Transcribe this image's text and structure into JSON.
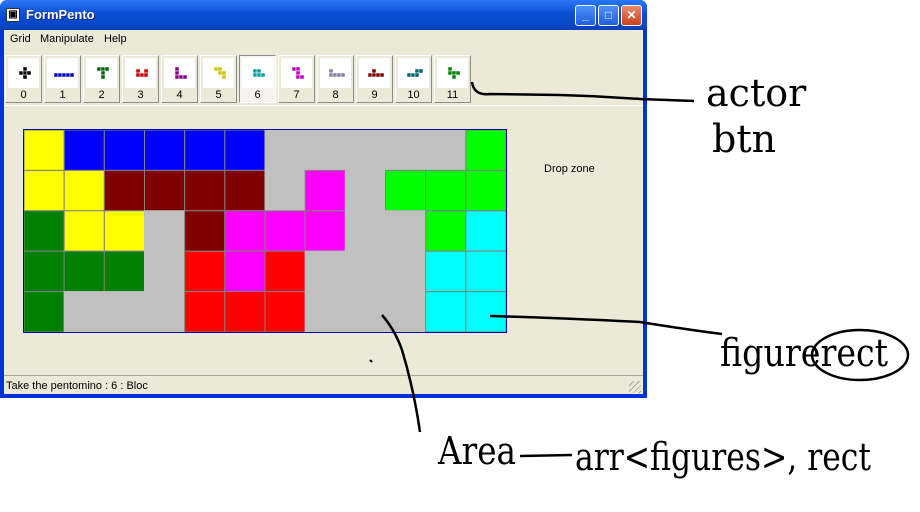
{
  "window": {
    "title": "FormPento",
    "app_icon": "app-icon",
    "controls": {
      "minimize": "_",
      "maximize": "□",
      "close": "✕"
    }
  },
  "menu": [
    {
      "label": "Grid",
      "accel": "G"
    },
    {
      "label": "Manipulate",
      "accel": "M"
    },
    {
      "label": "Help",
      "accel": "H"
    }
  ],
  "toolbar": {
    "selected_index": 6,
    "buttons": [
      {
        "label": "0",
        "color": "#000000"
      },
      {
        "label": "1",
        "color": "#0000c8"
      },
      {
        "label": "2",
        "color": "#006400"
      },
      {
        "label": "3",
        "color": "#c80000"
      },
      {
        "label": "4",
        "color": "#800080"
      },
      {
        "label": "5",
        "color": "#c8c800"
      },
      {
        "label": "6",
        "color": "#00a0a0"
      },
      {
        "label": "7",
        "color": "#c000c0"
      },
      {
        "label": "8",
        "color": "#8080a0"
      },
      {
        "label": "9",
        "color": "#800000"
      },
      {
        "label": "10",
        "color": "#006464"
      },
      {
        "label": "11",
        "color": "#008000"
      }
    ]
  },
  "board": {
    "cols": 12,
    "rows": 5,
    "empty_color": "#c0c0c0",
    "cells": [
      [
        "#ffff00",
        "#0000ff",
        "#0000ff",
        "#0000ff",
        "#0000ff",
        "#0000ff",
        "",
        "",
        "",
        "",
        "",
        "#00ff00"
      ],
      [
        "#ffff00",
        "#ffff00",
        "#800000",
        "#800000",
        "#800000",
        "#800000",
        "",
        "#ff00ff",
        "",
        "#00ff00",
        "#00ff00",
        "#00ff00"
      ],
      [
        "#008000",
        "#ffff00",
        "#ffff00",
        "",
        "#800000",
        "#ff00ff",
        "#ff00ff",
        "#ff00ff",
        "",
        "",
        "#00ff00",
        "#00ffff"
      ],
      [
        "#008000",
        "#008000",
        "#008000",
        "",
        "#ff0000",
        "#ff00ff",
        "#ff0000",
        "",
        "",
        "",
        "#00ffff",
        "#00ffff"
      ],
      [
        "#008000",
        "",
        "",
        "",
        "#ff0000",
        "#ff0000",
        "#ff0000",
        "",
        "",
        "",
        "#00ffff",
        "#00ffff"
      ]
    ]
  },
  "drop_zone_label": "Drop zone",
  "status": "Take the pentomino : 6 : Bloc",
  "annotations": {
    "actor_btn_line1": "actor",
    "actor_btn_line2": "btn",
    "figure_rect": "figurerect",
    "area_left": "Area",
    "area_right": "arr<figures>, rect"
  }
}
